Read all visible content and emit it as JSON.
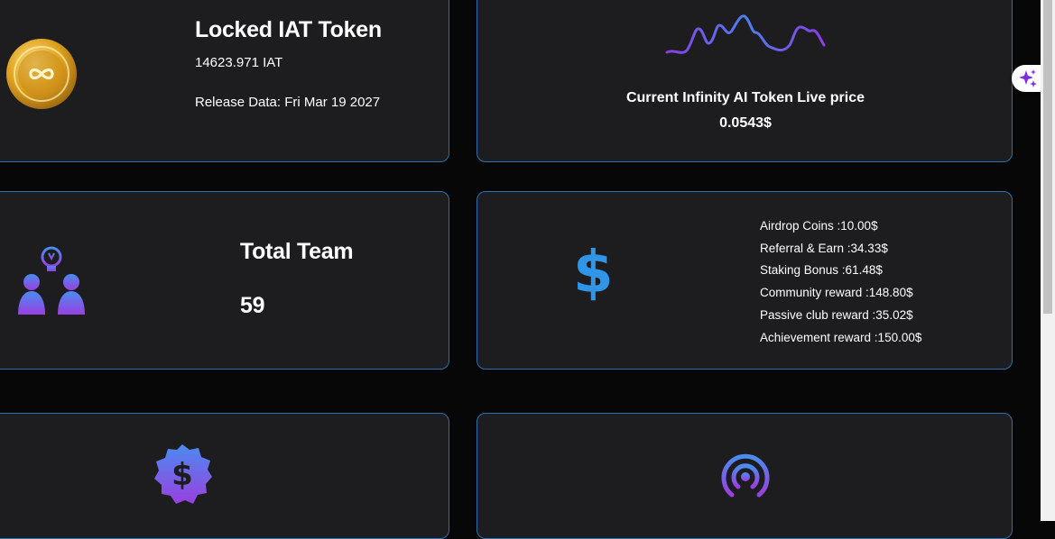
{
  "locked_token": {
    "title": "Locked IAT Token",
    "amount": "14623.971 IAT",
    "release": "Release Data: Fri Mar 19 2027"
  },
  "live_price": {
    "label": "Current Infinity AI Token Live price",
    "value": "0.0543$"
  },
  "team": {
    "title": "Total Team",
    "count": "59"
  },
  "income": {
    "items": [
      "Airdrop Coins :10.00$",
      "Referral & Earn :34.33$",
      "Staking Bonus :61.48$",
      "Community reward :148.80$",
      "Passive club reward :35.02$",
      "Achievement reward :150.00$"
    ]
  },
  "icons": {
    "coin": "infinity-coin-icon",
    "sparkline": "price-sparkline-icon",
    "team": "team-idea-icon",
    "dollar": "dollar-icon",
    "badge": "dollar-badge-icon",
    "broadcast": "broadcast-icon",
    "sparkle": "sparkle-icon"
  },
  "colors": {
    "background": "#070707",
    "card": "#1d1d1f",
    "card_border": "#2f6fb3",
    "accent_blue": "#2f95e8",
    "accent_purple": "#8b3ee0"
  }
}
